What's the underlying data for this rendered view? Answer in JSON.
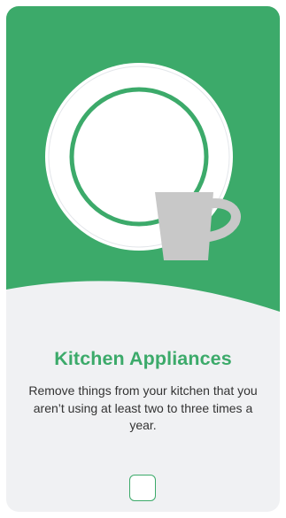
{
  "card": {
    "title": "Kitchen Appliances",
    "description": "Remove things from your kitchen that you aren’t using at least two to three times a year.",
    "checkbox": {
      "checked": false
    }
  },
  "colors": {
    "accent": "#3caa6a",
    "card_background": "#f0f1f3",
    "plate": "#ffffff",
    "mug": "#c8c8c8",
    "title_text": "#3caa6a",
    "body_text": "#333333",
    "checkbox_border": "#3caa6a"
  },
  "illustration": {
    "plate": "plate-icon",
    "mug": "mug-icon"
  }
}
